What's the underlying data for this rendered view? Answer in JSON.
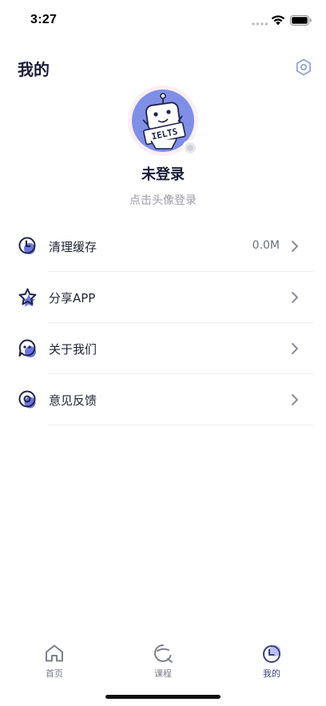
{
  "status_bar": {
    "time": "3:27"
  },
  "header": {
    "title": "我的"
  },
  "profile": {
    "avatar_text": "IELTS",
    "name": "未登录",
    "hint": "点击头像登录"
  },
  "menu": {
    "items": [
      {
        "label": "清理缓存",
        "value": "0.0M",
        "icon": "clock-icon"
      },
      {
        "label": "分享APP",
        "value": "",
        "icon": "star-icon"
      },
      {
        "label": "关于我们",
        "value": "",
        "icon": "chat-face-icon"
      },
      {
        "label": "意见反馈",
        "value": "",
        "icon": "disc-icon"
      }
    ]
  },
  "tab_bar": {
    "tabs": [
      {
        "label": "首页",
        "icon": "home-icon",
        "active": false
      },
      {
        "label": "课程",
        "icon": "course-icon",
        "active": false
      },
      {
        "label": "我的",
        "icon": "profile-icon",
        "active": true
      }
    ]
  },
  "colors": {
    "accent": "#5b6ad6",
    "avatar_bg": "#7f8fe6",
    "text": "#1a1d3a",
    "muted": "#9a9aa5"
  }
}
